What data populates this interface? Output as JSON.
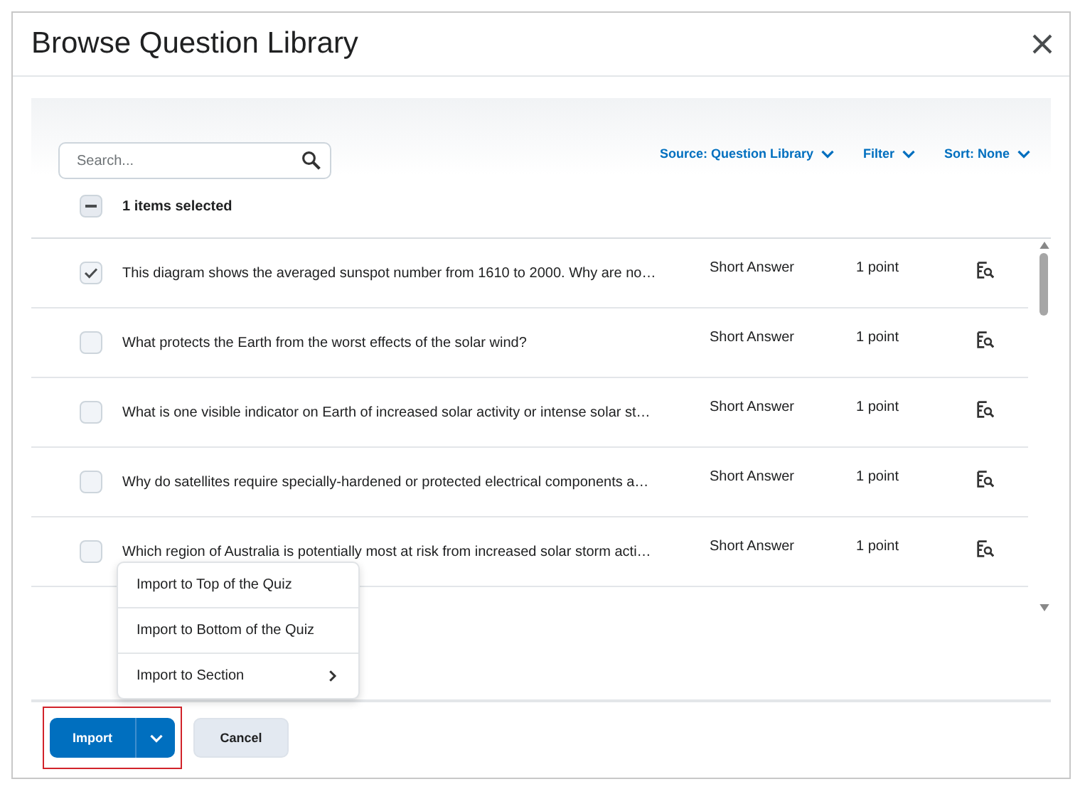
{
  "dialog": {
    "title": "Browse Question Library"
  },
  "search": {
    "placeholder": "Search..."
  },
  "toolbar_menus": [
    {
      "label": "Source: Question Library"
    },
    {
      "label": "Filter"
    },
    {
      "label": "Sort: None"
    }
  ],
  "selection": {
    "label": "1 items selected",
    "partial": true
  },
  "questions": [
    {
      "text": "This diagram shows the averaged sunspot number from 1610 to 2000. Why are no…",
      "type": "Short Answer",
      "points": "1 point",
      "checked": true
    },
    {
      "text": "What protects the Earth from the worst effects of the solar wind?",
      "type": "Short Answer",
      "points": "1 point",
      "checked": false
    },
    {
      "text": "What is one visible indicator on Earth of increased solar activity or intense solar st…",
      "type": "Short Answer",
      "points": "1 point",
      "checked": false
    },
    {
      "text": "Why do satellites require specially-hardened or protected electrical components a…",
      "type": "Short Answer",
      "points": "1 point",
      "checked": false
    },
    {
      "text": "Which region of Australia is potentially most at risk from increased solar storm acti…",
      "type": "Short Answer",
      "points": "1 point",
      "checked": false
    }
  ],
  "import_menu": [
    {
      "label": "Import to Top of the Quiz",
      "submenu": false
    },
    {
      "label": "Import to Bottom of the Quiz",
      "submenu": false
    },
    {
      "label": "Import to Section",
      "submenu": true
    }
  ],
  "buttons": {
    "import": "Import",
    "cancel": "Cancel"
  }
}
